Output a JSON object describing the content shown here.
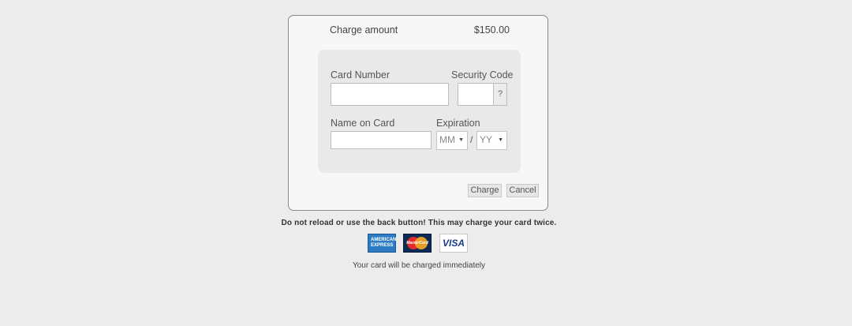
{
  "charge": {
    "label": "Charge amount",
    "amount": "$150.00"
  },
  "form": {
    "card_number_label": "Card Number",
    "card_number_value": "",
    "security_code_label": "Security Code",
    "security_code_value": "",
    "security_help": "?",
    "name_label": "Name on Card",
    "name_value": "",
    "expiration_label": "Expiration",
    "month_selected": "MM",
    "year_selected": "YY",
    "separator": "/"
  },
  "actions": {
    "charge_label": "Charge",
    "cancel_label": "Cancel"
  },
  "warning": "Do not reload or use the back button! This may charge your card twice.",
  "card_brands": {
    "amex_line1": "AMERICAN",
    "amex_line2": "EXPRESS",
    "mastercard": "MasterCard",
    "visa": "VISA"
  },
  "footnote": "Your card will be charged immediately",
  "colors": {
    "background": "#ececec",
    "panel": "#f7f7f7",
    "inner_panel": "#e9e9e9",
    "amex_blue": "#2d7cc3",
    "mastercard_navy": "#0d2a55",
    "visa_blue": "#1a3c8c"
  }
}
